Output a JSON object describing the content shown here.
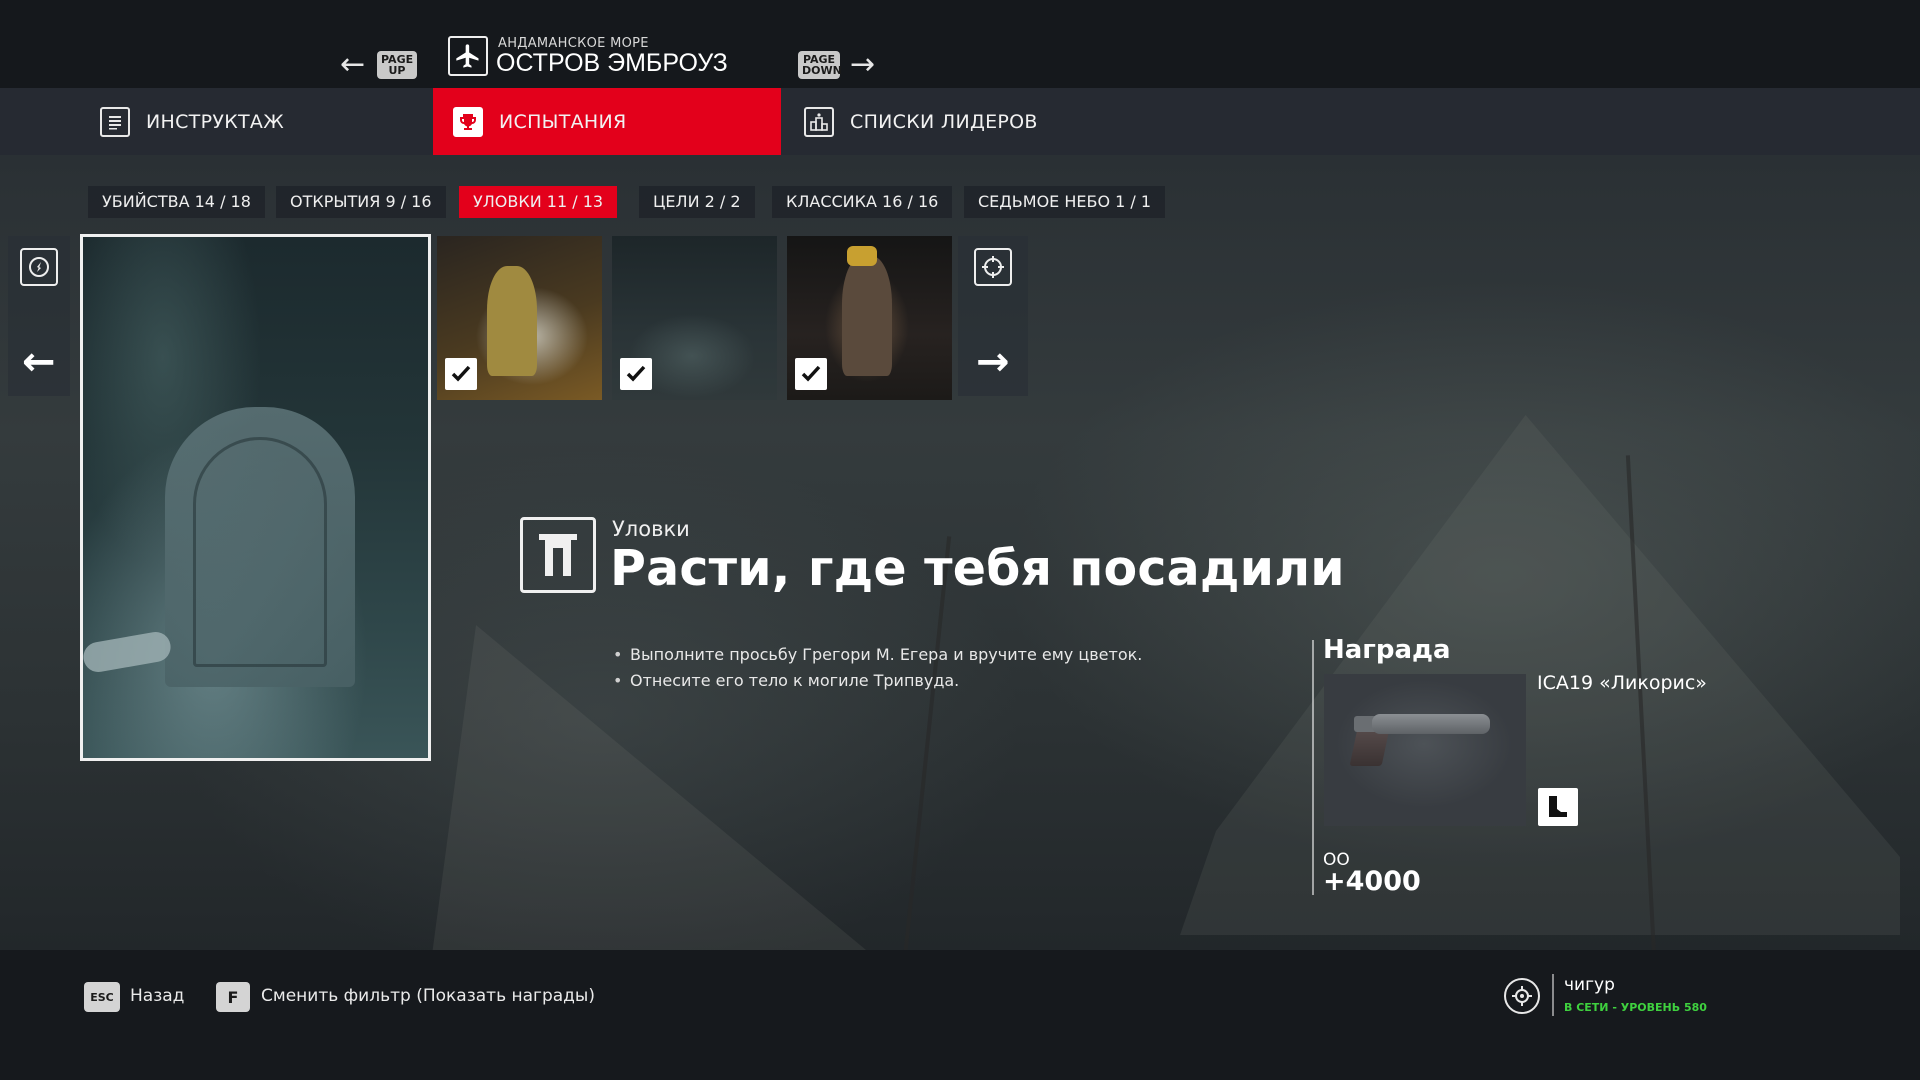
{
  "header": {
    "page_up_key": [
      "PAGE",
      "UP"
    ],
    "page_down_key": [
      "PAGE",
      "DOWN"
    ],
    "location_region": "АНДАМАНСКОЕ МОРЕ",
    "location_name": "ОСТРОВ ЭМБРОУЗ"
  },
  "main_tabs": [
    {
      "label": "ИНСТРУКТАЖ",
      "icon": "briefing-icon",
      "active": false
    },
    {
      "label": "ИСПЫТАНИЯ",
      "icon": "trophy-icon",
      "active": true
    },
    {
      "label": "СПИСКИ ЛИДЕРОВ",
      "icon": "leaderboard-icon",
      "active": false
    }
  ],
  "filter_tabs": [
    {
      "label": "УБИЙСТВА  14 / 18",
      "active": false
    },
    {
      "label": "ОТКРЫТИЯ  9 / 16",
      "active": false
    },
    {
      "label": "УЛОВКИ  11 / 13",
      "active": true
    },
    {
      "label": "ЦЕЛИ  2 / 2",
      "active": false
    },
    {
      "label": "КЛАССИКА  16 / 16",
      "active": false
    },
    {
      "label": "СЕДЬМОЕ НЕБО  1 / 1",
      "active": false
    }
  ],
  "challenge": {
    "category": "Уловки",
    "title": "Расти, где тебя посадили",
    "description": [
      "Выполните просьбу Грегори М. Егера и вручите ему цветок.",
      "Отнесите его тело к могиле Трипвуда."
    ]
  },
  "reward": {
    "heading": "Награда",
    "item_name": "ICA19 «Ликорис»",
    "xp_label": "ОО",
    "xp_value": "+4000"
  },
  "bottom": {
    "back_key": "ESC",
    "back_label": "Назад",
    "filter_key": "F",
    "filter_label": "Сменить фильтр (Показать награды)",
    "profile_name": "чигур",
    "profile_status": "В СЕТИ - УРОВЕНЬ 580"
  },
  "colors": {
    "accent": "#e3001b",
    "online": "#3fd13f"
  }
}
